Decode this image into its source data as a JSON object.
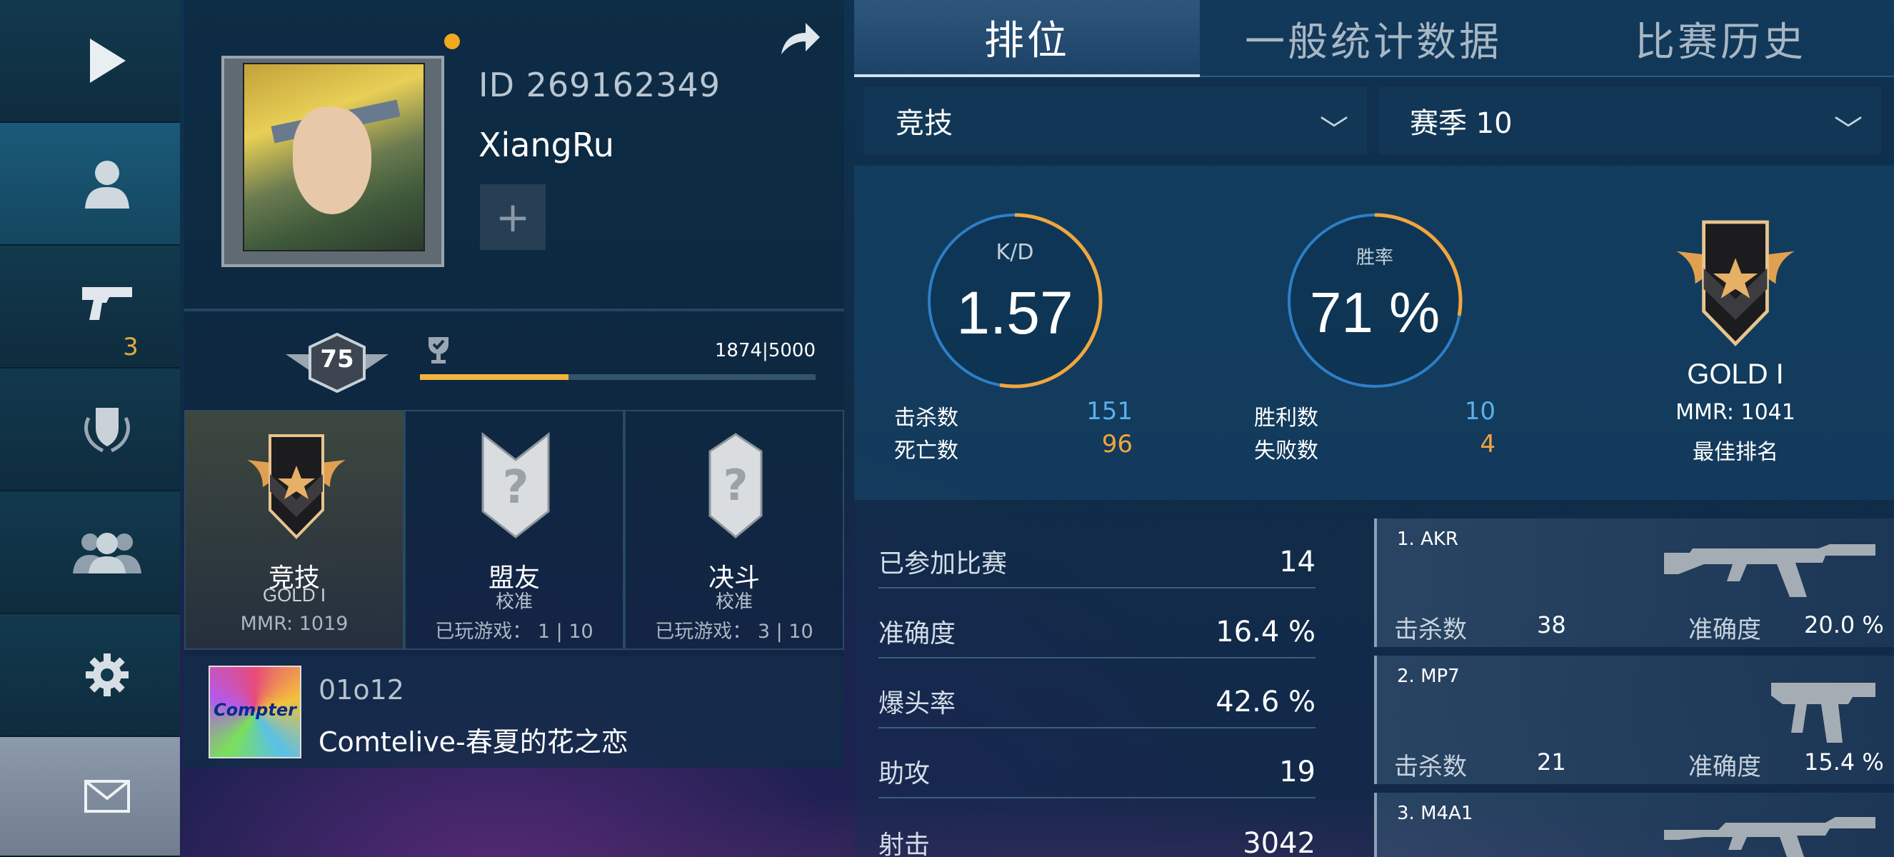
{
  "sidebar": {
    "items": [
      {
        "name": "play-icon"
      },
      {
        "name": "profile-icon"
      },
      {
        "name": "pistol-icon",
        "badge": "3"
      },
      {
        "name": "shield-laurel-icon"
      },
      {
        "name": "friends-icon"
      },
      {
        "name": "gear-icon"
      },
      {
        "name": "mail-icon"
      }
    ]
  },
  "profile": {
    "id_text": "ID 269162349",
    "name": "XiangRu",
    "add_label": "+",
    "level": "75",
    "xp_text": "1874|5000",
    "xp_progress": 0.3748,
    "modes": [
      {
        "title": "竞技",
        "rank": "GOLD I",
        "detail": "MMR: 1019"
      },
      {
        "title": "盟友",
        "sub": "校准",
        "detail": "已玩游戏： 1 | 10"
      },
      {
        "title": "决斗",
        "sub": "校准",
        "detail": "已玩游戏： 3 | 10"
      }
    ],
    "music": {
      "code": "01o12",
      "title": "Comtelive-春夏的花之恋",
      "art_text": "Compter"
    }
  },
  "tabs": [
    {
      "label": "排位"
    },
    {
      "label": "一般统计数据"
    },
    {
      "label": "比赛历史"
    }
  ],
  "filters": {
    "mode": "竞技",
    "season": "赛季 10"
  },
  "stats": {
    "kd": {
      "label": "K/D",
      "value": "1.57"
    },
    "winrate": {
      "label": "胜率",
      "value": "71 %"
    },
    "kills_label": "击杀数",
    "kills": "151",
    "deaths_label": "死亡数",
    "deaths": "96",
    "wins_label": "胜利数",
    "wins": "10",
    "losses_label": "失败数",
    "losses": "4",
    "rank": {
      "title": "GOLD I",
      "mmr": "MMR: 1041",
      "best": "最佳排名"
    }
  },
  "summary": [
    {
      "label": "已参加比赛",
      "value": "14"
    },
    {
      "label": "准确度",
      "value": "16.4 %"
    },
    {
      "label": "爆头率",
      "value": "42.6 %"
    },
    {
      "label": "助攻",
      "value": "19"
    },
    {
      "label": "射击",
      "value": "3042"
    }
  ],
  "weapons": [
    {
      "name": "1. AKR",
      "kills_label": "击杀数",
      "kills": "38",
      "acc_label": "准确度",
      "acc": "20.0 %"
    },
    {
      "name": "2. MP7",
      "kills_label": "击杀数",
      "kills": "21",
      "acc_label": "准确度",
      "acc": "15.4 %"
    },
    {
      "name": "3. M4A1",
      "kills_label": "",
      "kills": "",
      "acc_label": "",
      "acc": ""
    }
  ],
  "colors": {
    "accent_orange": "#f0a63e",
    "accent_blue": "#5ab0ea",
    "gold_bar": "#f2b33d"
  }
}
